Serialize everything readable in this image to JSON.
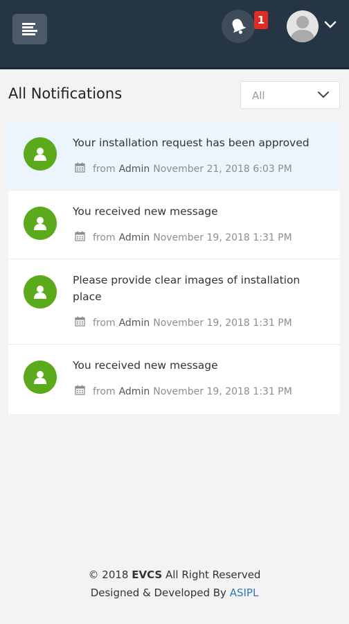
{
  "header": {
    "menu_icon": "menu-icon",
    "bell_icon": "bell-icon",
    "notification_count": "1",
    "avatar_icon": "user-avatar",
    "caret_icon": "chevron-down-icon",
    "colors": {
      "bar": "#263546",
      "badge": "#e02b27"
    }
  },
  "page": {
    "title": "All Notifications",
    "filter": {
      "selected": "All"
    }
  },
  "notifications": [
    {
      "message": "Your installation request has been approved",
      "from_label": "from",
      "author": "Admin",
      "date": "November 21, 2018 6:03 PM",
      "unread": true
    },
    {
      "message": "You received new message",
      "from_label": "from",
      "author": "Admin",
      "date": "November 19, 2018 1:31 PM",
      "unread": false
    },
    {
      "message": "Please provide clear images of installation place",
      "from_label": "from",
      "author": "Admin",
      "date": "November 19, 2018 1:31 PM",
      "unread": false
    },
    {
      "message": "You received new message",
      "from_label": "from",
      "author": "Admin",
      "date": "November 19, 2018 1:31 PM",
      "unread": false
    }
  ],
  "footer": {
    "copyright_prefix": "© 2018",
    "brand": "EVCS",
    "copyright_suffix": "All Right Reserved",
    "developed_prefix": "Designed & Developed By",
    "developer": "ASIPL",
    "link_color": "#2e78c2"
  },
  "icon_color": "#5aaa1c"
}
